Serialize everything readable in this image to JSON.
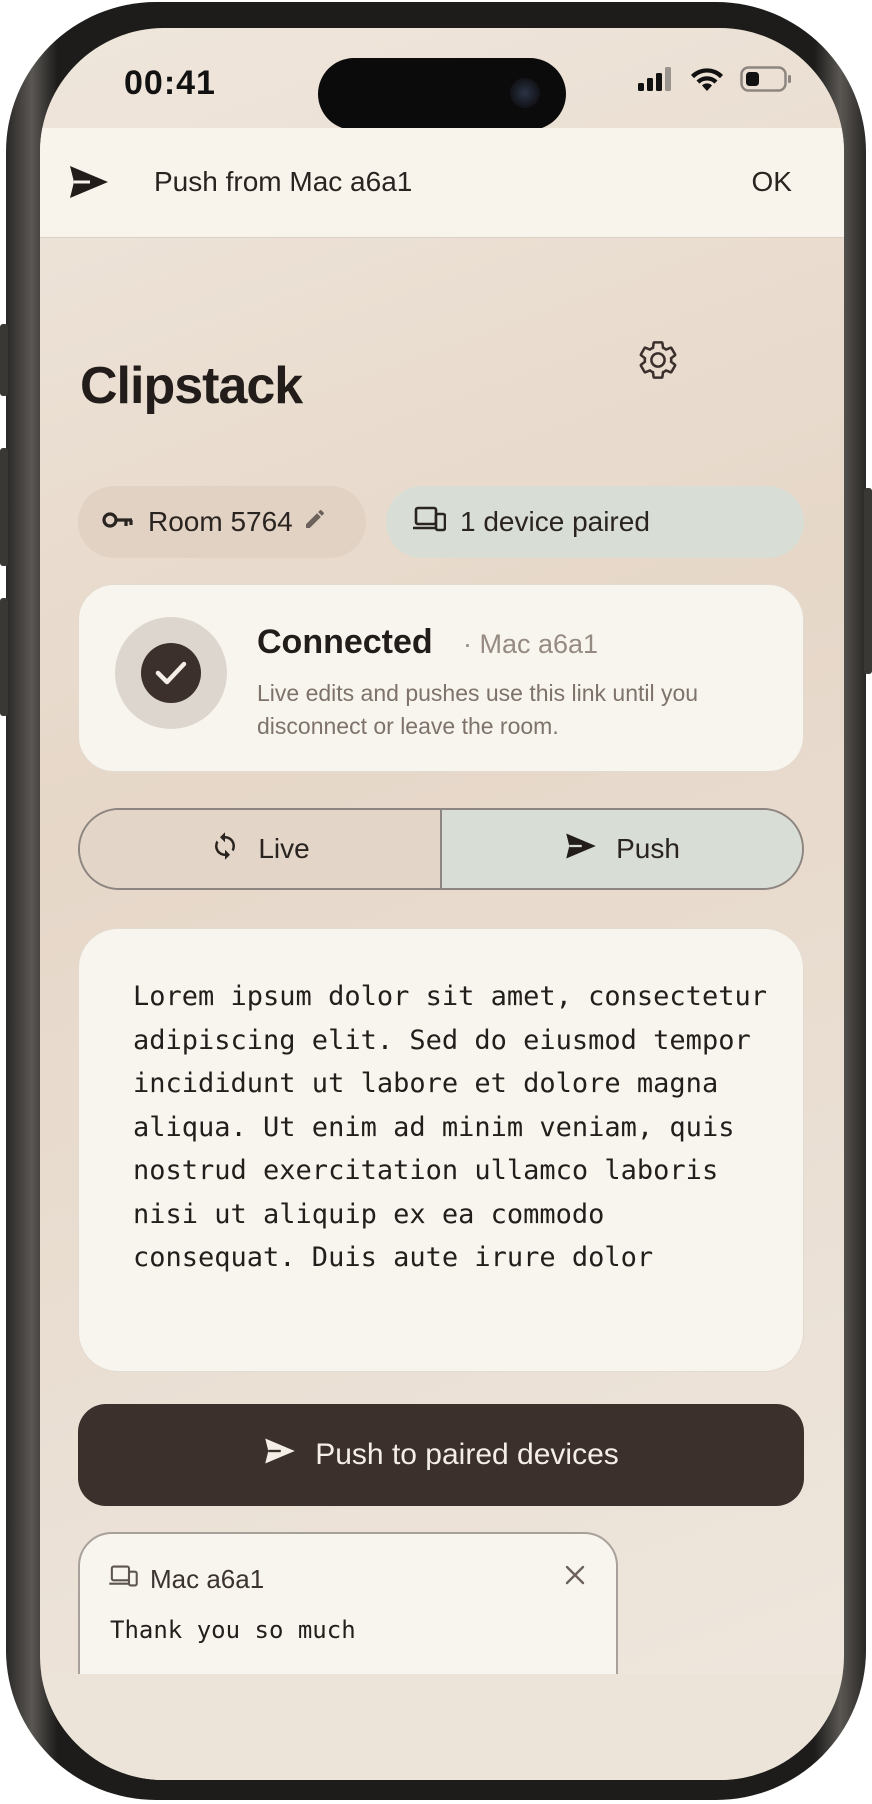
{
  "status_bar": {
    "time": "00:41"
  },
  "notification": {
    "icon": "send-icon",
    "text": "Push from Mac a6a1",
    "action": "OK"
  },
  "app": {
    "title": "Clipstack",
    "settings_icon": "gear-icon"
  },
  "room_chip": {
    "icon": "key-icon",
    "label": "Room 5764",
    "edit_icon": "pencil-icon"
  },
  "devices_chip": {
    "icon": "devices-icon",
    "label": "1 device paired"
  },
  "connection": {
    "title": "Connected",
    "peer": "· Mac a6a1",
    "description": "Live edits and pushes use this link until you disconnect or leave the room."
  },
  "mode_toggle": {
    "options": [
      {
        "label": "Live",
        "icon": "sync-icon",
        "selected": false
      },
      {
        "label": "Push",
        "icon": "send-icon",
        "selected": true
      }
    ]
  },
  "editor": {
    "text": "Lorem ipsum dolor sit amet, consectetur adipiscing elit. Sed do eiusmod tempor incididunt ut labore et dolore magna aliqua. Ut enim ad minim veniam, quis nostrud exercitation ullamco laboris nisi ut aliquip ex ea commodo consequat. Duis aute irure dolor"
  },
  "push_button": {
    "label": "Push to paired devices",
    "icon": "send-icon"
  },
  "received_clip": {
    "device": "Mac a6a1",
    "text": "Thank you so much",
    "close_icon": "close-icon"
  },
  "colors": {
    "accent_dark": "#3b302c",
    "chip_green": "#d8ddd5",
    "chip_beige": "#e2d2c4",
    "card_bg": "#f8f4ee"
  }
}
